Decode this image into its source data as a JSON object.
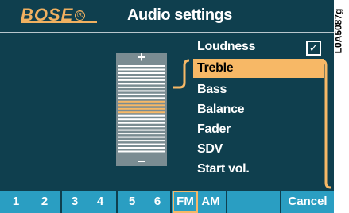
{
  "header": {
    "brand": "BOSE",
    "brand_mark": "®",
    "title": "Audio settings"
  },
  "slider": {
    "plus_label": "+",
    "minus_label": "–",
    "level_segments_highlighted": 4,
    "total_segments": 25
  },
  "menu": {
    "items": [
      {
        "label": "Loudness"
      },
      {
        "label": "Treble"
      },
      {
        "label": "Bass"
      },
      {
        "label": "Balance"
      },
      {
        "label": "Fader"
      },
      {
        "label": "SDV"
      },
      {
        "label": "Start vol."
      }
    ],
    "selected_index": 1,
    "loudness_checked": true,
    "check_glyph": "✓"
  },
  "bottom_bar": {
    "buttons": [
      "1",
      "2",
      "3",
      "4",
      "5",
      "6",
      "FM",
      "AM",
      "",
      "Cancel"
    ],
    "active": "FM"
  },
  "side_code": "L0A5087g",
  "colors": {
    "background": "#0f3f4e",
    "accent": "#f7b866",
    "bar": "#2a9ec2",
    "slider_bg": "#7a8c92"
  }
}
